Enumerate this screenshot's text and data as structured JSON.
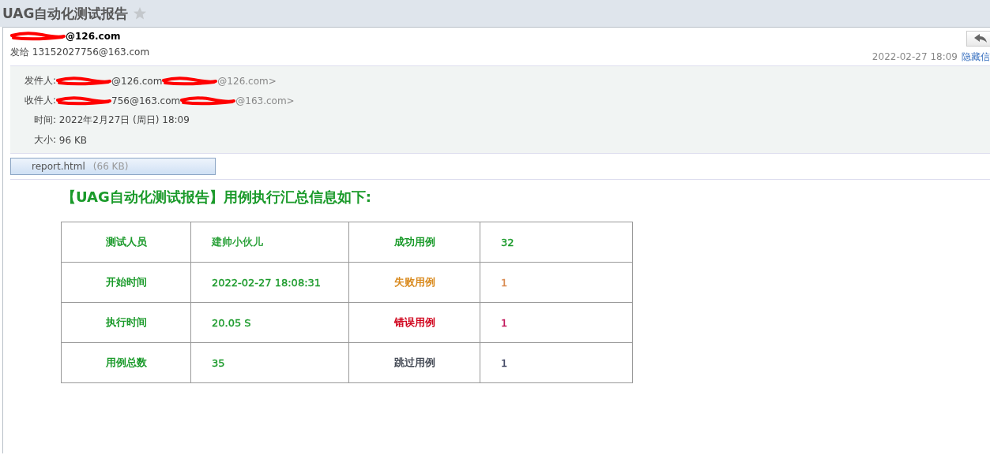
{
  "window": {
    "title": "UAG自动化测试报告",
    "starred": false
  },
  "header": {
    "sender": "@126.com",
    "recipient_line": "发给 13152027756@163.com",
    "date": "2022-02-27 18:09",
    "toggle_link": "隐藏信"
  },
  "details": [
    {
      "label": "发件人:",
      "value": "@126.com",
      "address": "@126.com>",
      "redacted": true
    },
    {
      "label": "收件人:",
      "value": "756@163.com",
      "address": "@163.com>",
      "redacted": true
    },
    {
      "label": "时间:",
      "value": "2022年2月27日 (周日) 18:09",
      "redacted": false
    },
    {
      "label": "大小:",
      "value": "96 KB",
      "redacted": false
    }
  ],
  "attachment": {
    "name": "report.html",
    "size": "(66 KB)"
  },
  "report": {
    "heading": "【UAG自动化测试报告】用例执行汇总信息如下:",
    "rows": [
      [
        {
          "text": "测试人员",
          "color": "#1a9a2a"
        },
        {
          "text": "建帅小伙儿",
          "color": "#1a9a2a"
        },
        {
          "text": "成功用例",
          "color": "#1a9a2a"
        },
        {
          "text": "32",
          "color": "#1a9a2a"
        }
      ],
      [
        {
          "text": "开始时间",
          "color": "#1a9a2a"
        },
        {
          "text": "2022-02-27 18:08:31",
          "color": "#1a9a2a"
        },
        {
          "text": "失败用例",
          "color": "#d98a1e"
        },
        {
          "text": "1",
          "color": "#d98a50"
        }
      ],
      [
        {
          "text": "执行时间",
          "color": "#1a9a2a"
        },
        {
          "text": "20.05 S",
          "color": "#1a9a2a"
        },
        {
          "text": "错误用例",
          "color": "#d0021b"
        },
        {
          "text": "1",
          "color": "#c2185b"
        }
      ],
      [
        {
          "text": "用例总数",
          "color": "#1a9a2a"
        },
        {
          "text": "35",
          "color": "#1a9a2a"
        },
        {
          "text": "跳过用例",
          "color": "#444a55"
        },
        {
          "text": "1",
          "color": "#444a66"
        }
      ]
    ]
  }
}
